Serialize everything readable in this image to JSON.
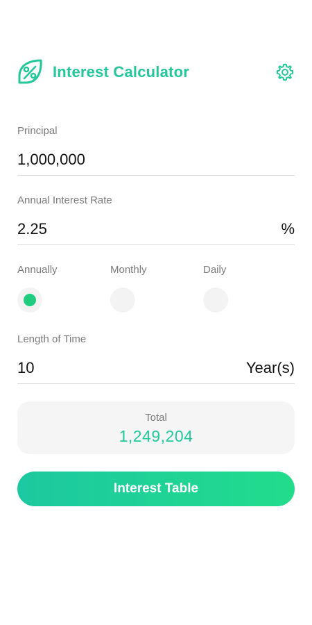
{
  "header": {
    "title": "Interest Calculator",
    "logo_icon": "percent-leaf-icon",
    "settings_icon": "gear-icon"
  },
  "principal": {
    "label": "Principal",
    "value": "1,000,000"
  },
  "rate": {
    "label": "Annual Interest Rate",
    "value": "2.25",
    "unit": "%"
  },
  "frequency": {
    "options": [
      "Annually",
      "Monthly",
      "Daily"
    ],
    "selected": "Annually"
  },
  "time": {
    "label": "Length of Time",
    "value": "10",
    "unit": "Year(s)"
  },
  "total": {
    "label": "Total",
    "value": "1,249,204"
  },
  "button": {
    "label": "Interest Table"
  },
  "colors": {
    "accent": "#22c79a",
    "gradient_start": "#1cc8a0",
    "gradient_end": "#22dc8c",
    "selected_dot": "#22cc7e"
  }
}
